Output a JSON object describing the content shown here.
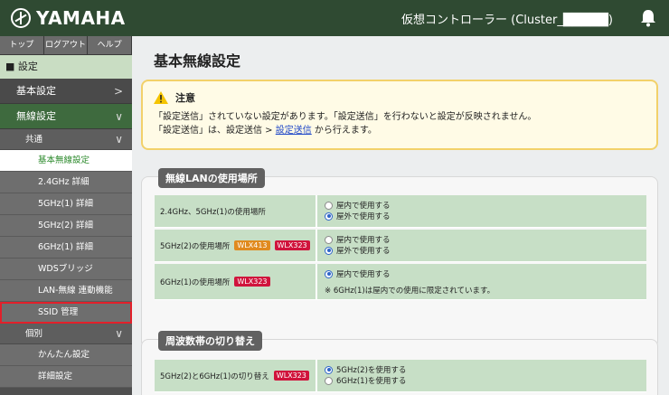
{
  "header": {
    "brand": "YAMAHA",
    "controller": "仮想コントローラー (Cluster_█████)",
    "colors": {
      "bar": "#2f4a32"
    }
  },
  "sidebar": {
    "tabs": [
      "トップ",
      "ログアウト",
      "ヘルプ"
    ],
    "section": "■ 設定",
    "items": [
      {
        "label": "基本設定",
        "type": "nav1",
        "chevron": ">"
      },
      {
        "label": "無線設定",
        "type": "nav1",
        "chevron": "∨"
      },
      {
        "label": "共通",
        "type": "nav2",
        "chevron": "∨"
      },
      {
        "label": "基本無線設定",
        "type": "nav3"
      },
      {
        "label": "2.4GHz 詳細",
        "type": "nav3"
      },
      {
        "label": "5GHz(1) 詳細",
        "type": "nav3"
      },
      {
        "label": "5GHz(2) 詳細",
        "type": "nav3"
      },
      {
        "label": "6GHz(1) 詳細",
        "type": "nav3"
      },
      {
        "label": "WDSブリッジ",
        "type": "nav3"
      },
      {
        "label": "LAN-無線 連動機能",
        "type": "nav3"
      },
      {
        "label": "SSID 管理",
        "type": "nav3"
      },
      {
        "label": "個別",
        "type": "nav2",
        "chevron": "∨"
      },
      {
        "label": "かんたん設定",
        "type": "nav3"
      },
      {
        "label": "詳細設定",
        "type": "nav3"
      }
    ]
  },
  "main": {
    "title": "基本無線設定",
    "notice": {
      "heading": "注意",
      "line1": "「設定送信」されていない設定があります。「設定送信」を行わないと設定が反映されません。",
      "line2_prefix": "「設定送信」は、設定送信 > ",
      "line2_link": "設定送信",
      "line2_suffix": " から行えます。"
    },
    "section1": {
      "title": "無線LANの使用場所",
      "rows": [
        {
          "label": "2.4GHz、5GHz(1)の使用場所",
          "options": [
            "屋内で使用する",
            "屋外で使用する"
          ],
          "selected": 1
        },
        {
          "label": "5GHz(2)の使用場所",
          "badges": [
            "WLX413",
            "WLX323"
          ],
          "options": [
            "屋内で使用する",
            "屋外で使用する"
          ],
          "selected": 1
        },
        {
          "label": "6GHz(1)の使用場所",
          "badges": [
            "WLX323"
          ],
          "options": [
            "屋内で使用する"
          ],
          "selected": 0,
          "note": "※ 6GHz(1)は屋内での使用に限定されています。"
        }
      ]
    },
    "section2": {
      "title": "周波数帯の切り替え",
      "rows": [
        {
          "label": "5GHz(2)と6GHz(1)の切り替え",
          "badges": [
            "WLX323"
          ],
          "options": [
            "5GHz(2)を使用する",
            "6GHz(1)を使用する"
          ],
          "selected": 0
        }
      ]
    }
  }
}
